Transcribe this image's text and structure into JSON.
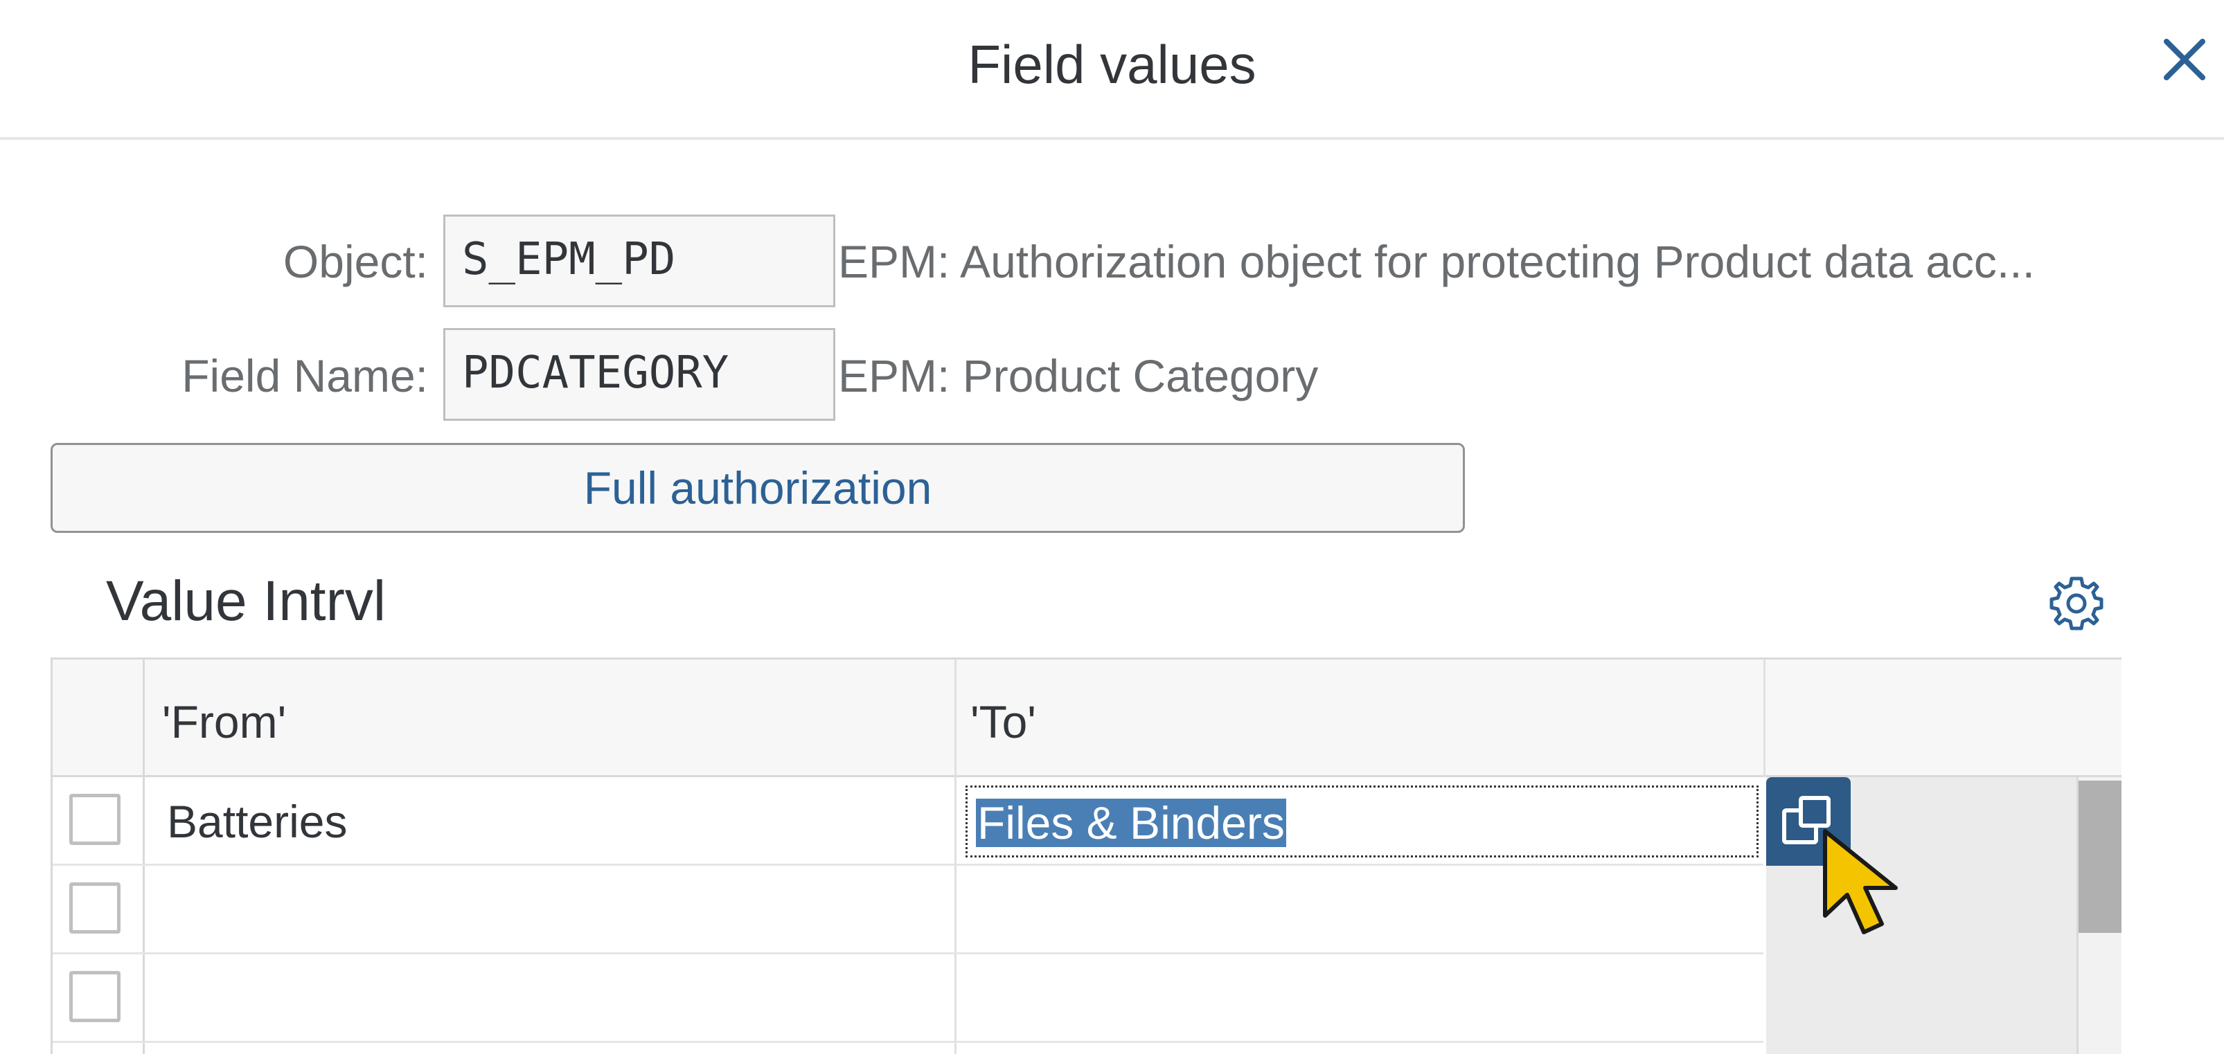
{
  "dialog": {
    "title": "Field values",
    "close_icon": "close-icon"
  },
  "form": {
    "object_label": "Object:",
    "object_value": "S_EPM_PD",
    "object_description": "EPM: Authorization object for protecting Product data acc...",
    "field_label": "Field Name:",
    "field_value": "PDCATEGORY",
    "field_description": "EPM: Product Category"
  },
  "full_authorization_label": "Full authorization",
  "section": {
    "title": "Value Intrvl",
    "settings_icon": "gear-icon"
  },
  "table": {
    "columns": [
      "'From'",
      "'To'"
    ],
    "rows": [
      {
        "from": "Batteries",
        "to": "Files & Binders",
        "selected": false
      },
      {
        "from": "",
        "to": "",
        "selected": false
      },
      {
        "from": "",
        "to": "",
        "selected": false
      }
    ],
    "value_help_icon": "value-help-icon"
  },
  "colors": {
    "accent": "#2c6195",
    "selection": "#4a7fb5",
    "value_help_button": "#2d5a86",
    "cursor": "#f5c400"
  }
}
